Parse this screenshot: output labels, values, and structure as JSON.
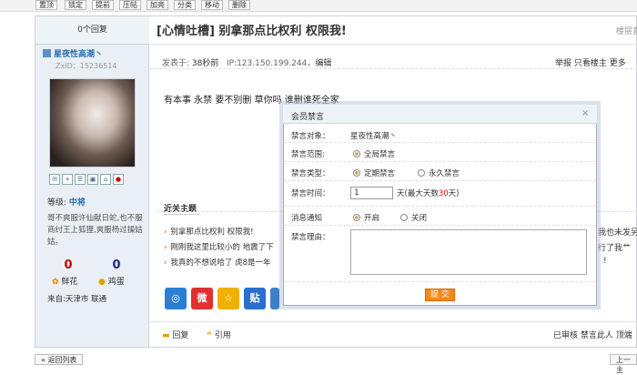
{
  "modbar": {
    "buttons": [
      "置顶",
      "锁定",
      "提前",
      "压帖",
      "加亮",
      "分类",
      "移动",
      "删除"
    ]
  },
  "sidebar": {
    "reply_count": "0个回复",
    "user_name": "星夜性高潮丶",
    "zxd_id": "ZxID：15236514",
    "rank_label": "等级:",
    "rank_name": "中将",
    "signature": "哥不爽服许仙献日蛇,也不服商纣王上狐狸,爽服杨过操姑姑。",
    "flowers": "0",
    "eggs": "0",
    "flower_label": "鲜花",
    "egg_label": "鸡蛋",
    "origin": "来自:天津市 联通"
  },
  "thread": {
    "title": "[心情吐槽] 别拿那点比权利 权限我!",
    "top_right": "楼层直",
    "post_time_prefix": "发表于: ",
    "post_time": "38秒前",
    "ip": "IP:123.150.199.244",
    "edit": "编辑",
    "actions_right": "举报  只看楼主  更多",
    "body": "有本事 永禁 要不别删  草你吗 谁删谁死全家"
  },
  "related": {
    "title": "近关主题",
    "items": [
      "别拿那点比权利 权限我!",
      "刚刚我这里比较小的 地震了下",
      "我真的不想说哈了 虎8是一年"
    ],
    "right_fragments": [
      "我也未发另",
      "行了我艹",
      "!"
    ]
  },
  "share": {
    "icons": [
      "ring-share",
      "weibo-share",
      "star-share",
      "tieba-share"
    ],
    "labels": [
      "◎",
      "微",
      "☆",
      "贴"
    ]
  },
  "bottom": {
    "reply": "回复",
    "quote": "引用",
    "right": "已审核  禁言此人  顶端",
    "back": "« 返回列表",
    "next": "上一主"
  },
  "dialog": {
    "title": "会员禁言",
    "close": "×",
    "target_label": "禁言对象：",
    "target_value": "星夜性高潮丶",
    "scope_label": "禁言范围:",
    "scope_option": "全局禁言",
    "type_label": "禁言类型：",
    "type_options": [
      "定期禁言",
      "永久禁言"
    ],
    "time_label": "禁言时间：",
    "time_value": "1",
    "time_suffix_pre": "天(最大天数",
    "time_max": "30",
    "time_suffix_post": "天)",
    "notify_label": "消息通知",
    "notify_options": [
      "开启",
      "关闭"
    ],
    "reason_label": "禁言理由：",
    "submit": "提 交"
  },
  "colors": {
    "accent": "#2c6fad",
    "submit": "#f08a1c",
    "sidebar_bg": "#e9eff5"
  }
}
